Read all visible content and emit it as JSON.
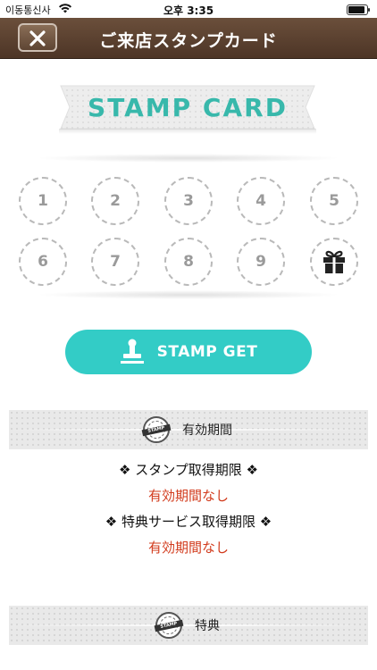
{
  "status_bar": {
    "carrier": "이동통신사",
    "time": "오후 3:35",
    "battery_level": 1.0
  },
  "header": {
    "title": "ご来店スタンプカード",
    "close_icon": "close-icon"
  },
  "banner": {
    "text": "STAMP CARD"
  },
  "stamps": {
    "slots": [
      "1",
      "2",
      "3",
      "4",
      "5",
      "6",
      "7",
      "8",
      "9"
    ],
    "reward_icon": "gift-icon"
  },
  "stamp_button": {
    "label": "STAMP GET",
    "icon": "stamp-icon"
  },
  "validity_section": {
    "title": "有効期間",
    "seal_text": "STAMP",
    "stamp_deadline_heading": "❖ スタンプ取得期限 ❖",
    "stamp_deadline_value": "有効期間なし",
    "benefit_deadline_heading": "❖ 特典サービス取得期限 ❖",
    "benefit_deadline_value": "有効期間なし"
  },
  "benefit_section": {
    "title": "特典",
    "seal_text": "STAMP"
  },
  "colors": {
    "accent": "#33ccc6",
    "banner_text": "#38b8ab",
    "nav_bar": "#5a3f2d",
    "deadline_value": "#d23c1e"
  }
}
